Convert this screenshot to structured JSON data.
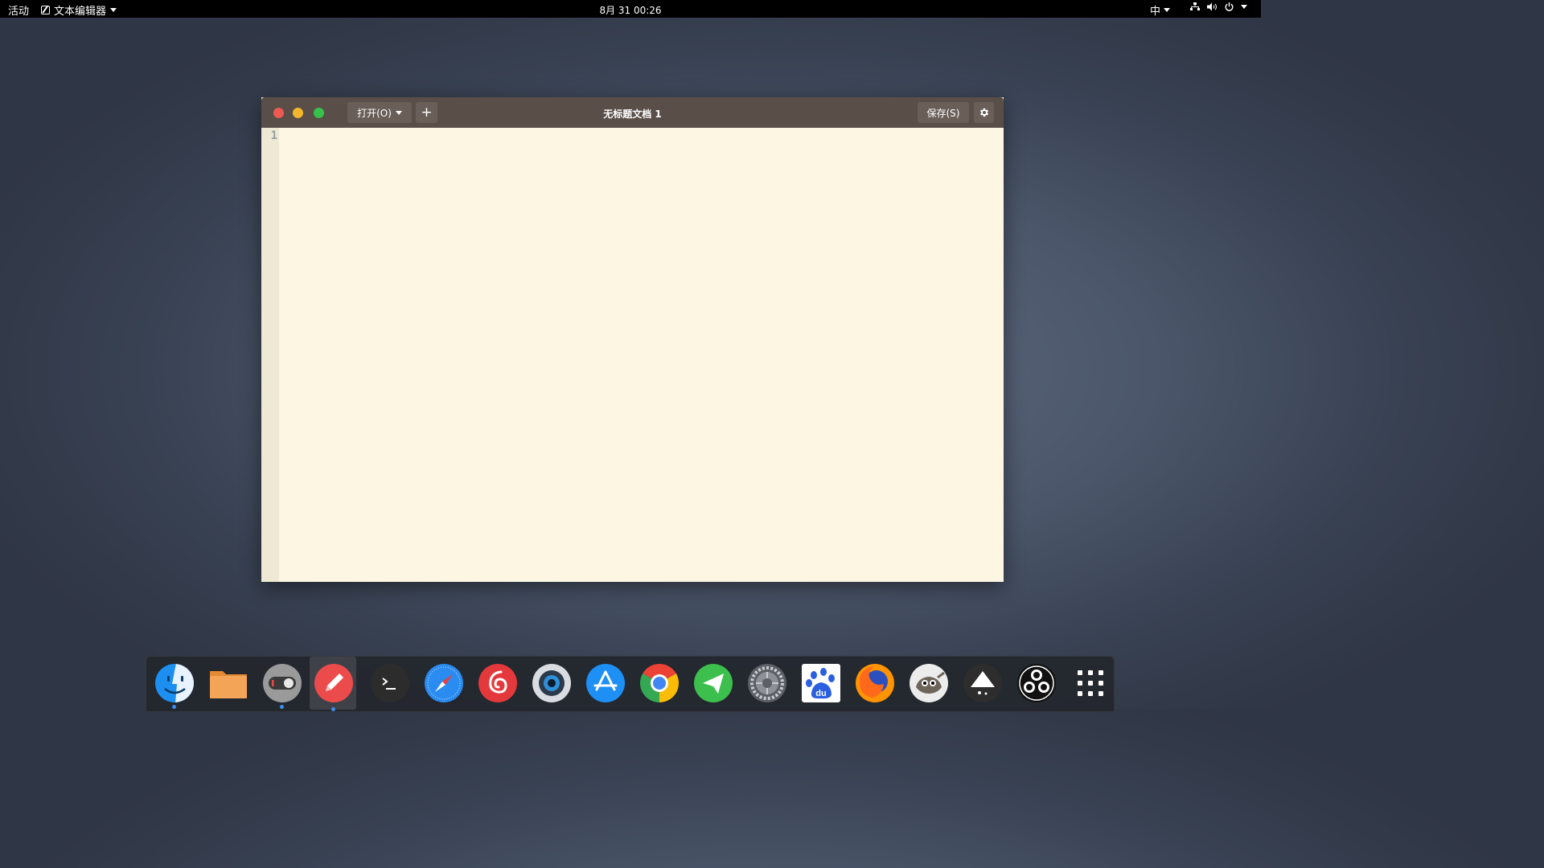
{
  "topbar": {
    "activities": "活动",
    "app_name": "文本编辑器",
    "clock": "8月 31  00:26",
    "input_method": "中"
  },
  "window": {
    "title": "无标题文档 1",
    "open_label": "打开(O)",
    "new_tab_label": "+",
    "save_label": "保存(S)",
    "line_numbers": [
      "1"
    ],
    "content": ""
  },
  "dock": {
    "items": [
      {
        "name": "finder",
        "running": true,
        "active": false
      },
      {
        "name": "files",
        "running": false,
        "active": false
      },
      {
        "name": "tweaks",
        "running": true,
        "active": false
      },
      {
        "name": "text-editor",
        "running": true,
        "active": true
      },
      {
        "name": "terminal",
        "running": false,
        "active": false
      },
      {
        "name": "safari",
        "running": false,
        "active": false
      },
      {
        "name": "netease-music",
        "running": false,
        "active": false
      },
      {
        "name": "camera",
        "running": false,
        "active": false
      },
      {
        "name": "app-store",
        "running": false,
        "active": false
      },
      {
        "name": "chrome",
        "running": false,
        "active": false
      },
      {
        "name": "telegram",
        "running": false,
        "active": false
      },
      {
        "name": "system-settings",
        "running": false,
        "active": false
      },
      {
        "name": "baidu",
        "running": false,
        "active": false
      },
      {
        "name": "firefox",
        "running": false,
        "active": false
      },
      {
        "name": "gimp",
        "running": false,
        "active": false
      },
      {
        "name": "inkscape",
        "running": false,
        "active": false
      },
      {
        "name": "obs",
        "running": false,
        "active": false
      },
      {
        "name": "show-apps",
        "running": false,
        "active": false
      }
    ]
  }
}
